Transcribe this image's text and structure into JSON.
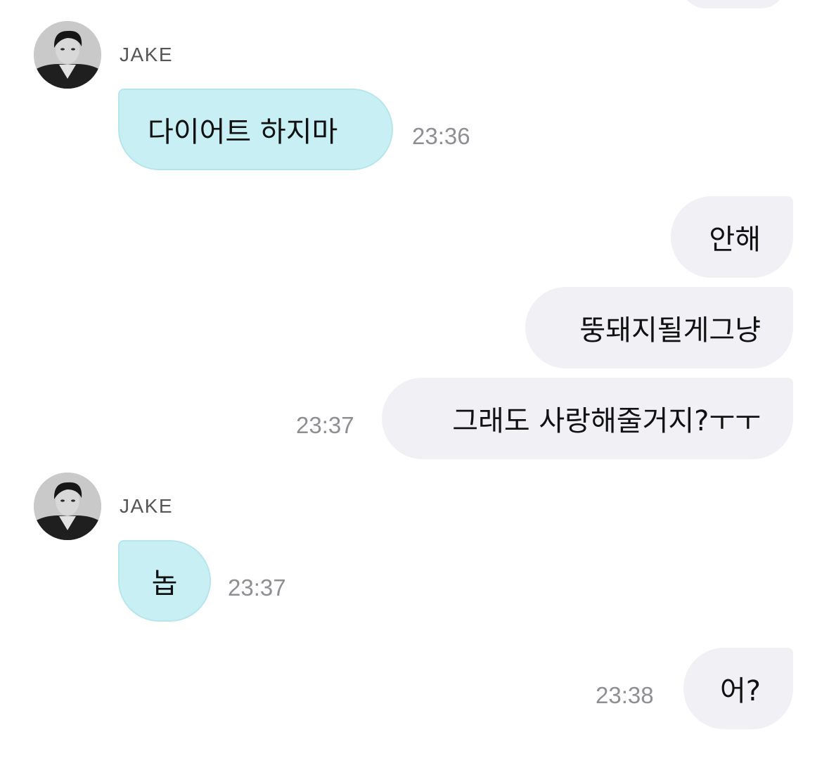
{
  "colors": {
    "incoming_bubble": "#c8f0f4",
    "outgoing_bubble": "#f1f1f5",
    "timestamp": "#8e8e93",
    "sender_name": "#555555"
  },
  "messages": [
    {
      "direction": "incoming",
      "sender": "JAKE",
      "avatar": "avatar-photo",
      "text": "다이어트 하지마",
      "time": "23:36"
    },
    {
      "direction": "outgoing",
      "text": "안해"
    },
    {
      "direction": "outgoing",
      "text": "뚱돼지될게그냥"
    },
    {
      "direction": "outgoing",
      "text": "그래도 사랑해줄거지?ㅜㅜ",
      "time": "23:37"
    },
    {
      "direction": "incoming",
      "sender": "JAKE",
      "avatar": "avatar-photo",
      "text": "놉",
      "time": "23:37"
    },
    {
      "direction": "outgoing",
      "text": "어?",
      "time": "23:38"
    }
  ]
}
